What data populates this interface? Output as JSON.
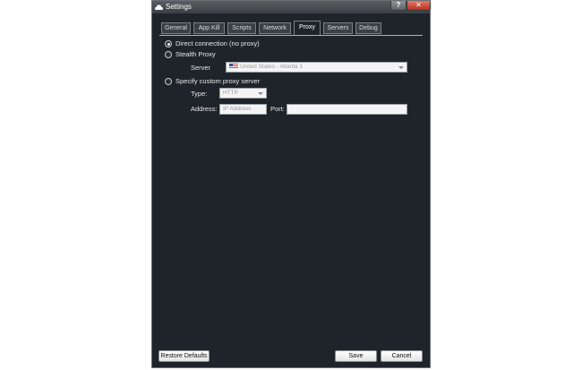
{
  "window": {
    "title": "Settings",
    "help_label": "?",
    "close_label": "✕"
  },
  "tabs": [
    {
      "label": "General",
      "active": false
    },
    {
      "label": "App Kill",
      "active": false
    },
    {
      "label": "Scripts",
      "active": false
    },
    {
      "label": "Network",
      "active": false
    },
    {
      "label": "Proxy",
      "active": true
    },
    {
      "label": "Servers",
      "active": false
    },
    {
      "label": "Debug",
      "active": false
    }
  ],
  "proxy": {
    "direct": {
      "label": "Direct connection (no proxy)",
      "checked": true
    },
    "stealth": {
      "label": "Stealth Proxy",
      "checked": false
    },
    "server_label": "Server",
    "server_value": "United States - Atlanta 1",
    "custom": {
      "label": "Specify custom proxy server",
      "checked": false
    },
    "type_label": "Type:",
    "type_value": "HTTP",
    "address_label": "Address:",
    "address_placeholder": "IP Address",
    "port_label": "Port:",
    "port_value": ""
  },
  "footer": {
    "restore_label": "Restore Defaults",
    "save_label": "Save",
    "cancel_label": "Cancel"
  }
}
